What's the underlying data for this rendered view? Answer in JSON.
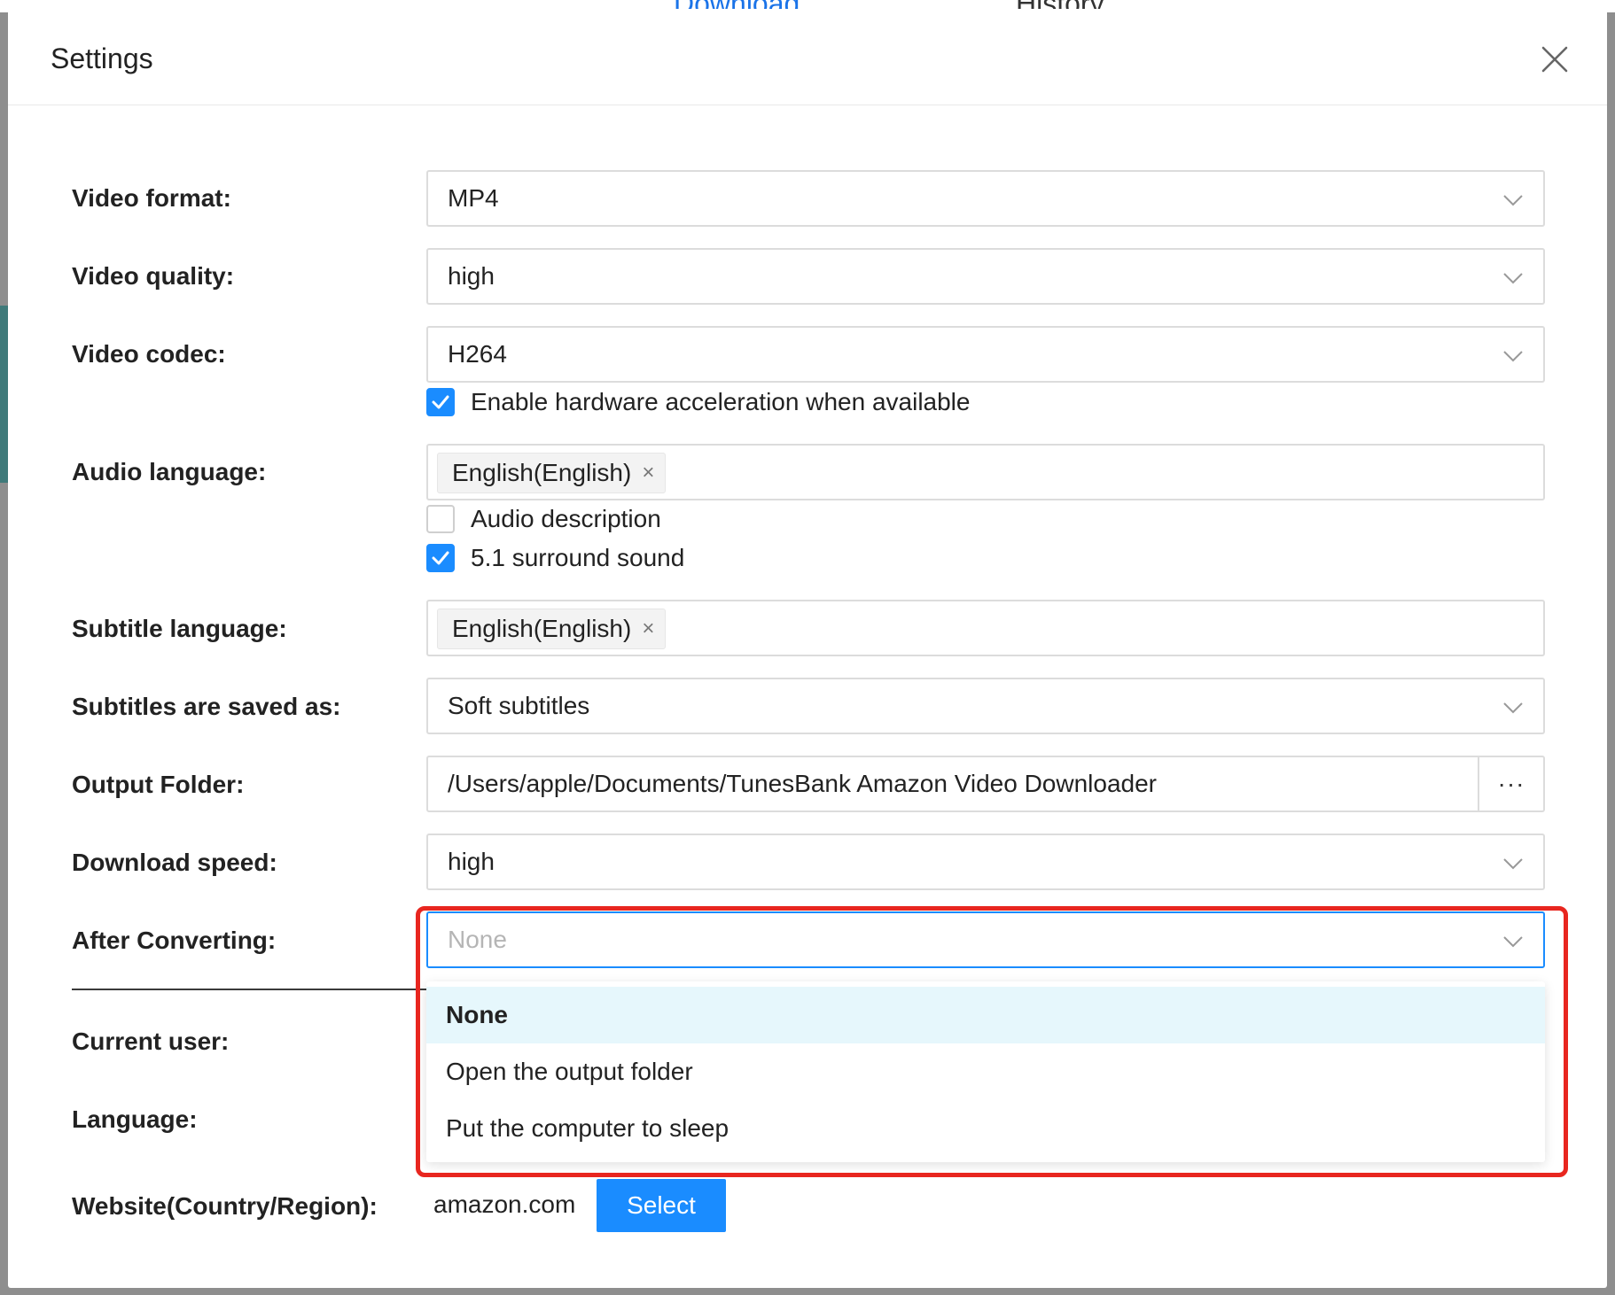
{
  "background": {
    "tabs": [
      {
        "label": "Download"
      },
      {
        "label": "History"
      }
    ]
  },
  "dialog": {
    "title": "Settings",
    "close_icon": "close-icon"
  },
  "settings": {
    "video_format": {
      "label": "Video format:",
      "value": "MP4"
    },
    "video_quality": {
      "label": "Video quality:",
      "value": "high"
    },
    "video_codec": {
      "label": "Video codec:",
      "value": "H264"
    },
    "hw_accel": {
      "label": "Enable hardware acceleration when available",
      "checked": true
    },
    "audio_language": {
      "label": "Audio language:",
      "tag": "English(English)",
      "tag_remove": "×"
    },
    "audio_description": {
      "label": "Audio description",
      "checked": false
    },
    "surround": {
      "label": "5.1 surround sound",
      "checked": true
    },
    "subtitle_language": {
      "label": "Subtitle language:",
      "tag": "English(English)",
      "tag_remove": "×"
    },
    "subtitles_saved_as": {
      "label": "Subtitles are saved as:",
      "value": "Soft subtitles"
    },
    "output_folder": {
      "label": "Output Folder:",
      "value": "/Users/apple/Documents/TunesBank Amazon Video Downloader",
      "browse": "···"
    },
    "download_speed": {
      "label": "Download speed:",
      "value": "high"
    },
    "after_converting": {
      "label": "After Converting:",
      "placeholder": "None",
      "options": [
        "None",
        "Open the output folder",
        "Put the computer to sleep"
      ],
      "selected": "None"
    },
    "current_user": {
      "label": "Current user:"
    },
    "language": {
      "label": "Language:"
    },
    "website": {
      "label": "Website(Country/Region):",
      "value": "amazon.com",
      "button": "Select"
    }
  },
  "colors": {
    "accent": "#1a8cff",
    "highlight": "#e8261f",
    "selected_bg": "#e6f7fc"
  }
}
